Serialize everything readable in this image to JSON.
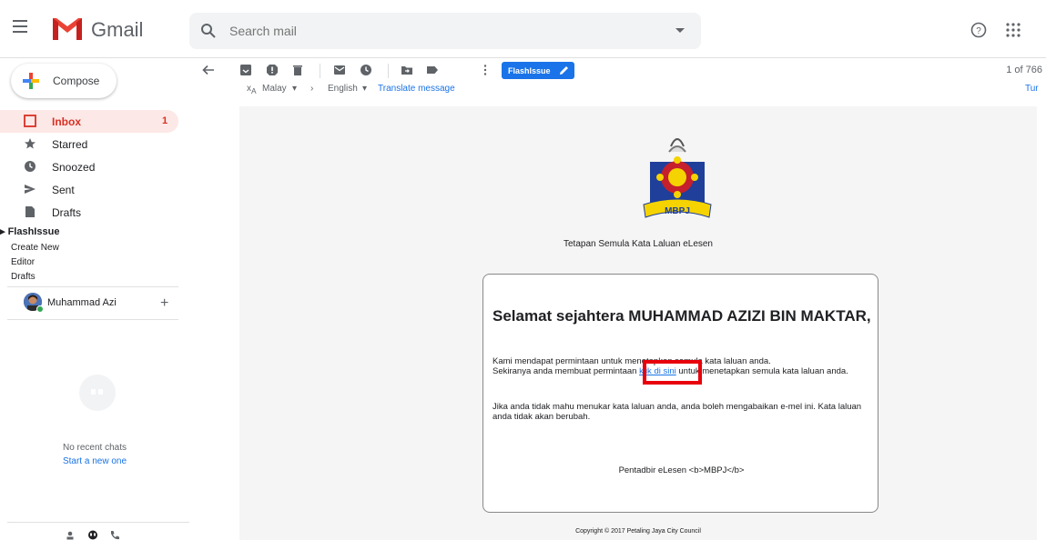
{
  "app": {
    "brand": "Gmail"
  },
  "search": {
    "placeholder": "Search mail"
  },
  "compose": {
    "label": "Compose"
  },
  "sidebar": {
    "items": [
      {
        "label": "Inbox",
        "count": "1",
        "icon": "inbox-icon",
        "active": true
      },
      {
        "label": "Starred",
        "icon": "star-icon"
      },
      {
        "label": "Snoozed",
        "icon": "clock-icon"
      },
      {
        "label": "Sent",
        "icon": "send-icon"
      },
      {
        "label": "Drafts",
        "icon": "draft-icon"
      }
    ],
    "label_group": {
      "title": "FlashIssue",
      "items": [
        "Create New",
        "Editor",
        "Drafts"
      ]
    },
    "user": {
      "name": "Muhammad Azi"
    },
    "chats": {
      "empty": "No recent chats",
      "start": "Start a new one"
    }
  },
  "toolbar": {
    "label_chip": "FlashIssue",
    "pager": "1 of 766"
  },
  "translate": {
    "from": "Malay",
    "to": "English",
    "action": "Translate message",
    "off": "Tur"
  },
  "email": {
    "heading": "Tetapan Semula Kata Laluan eLesen",
    "greeting": "Selamat sejahtera MUHAMMAD AZIZI BIN MAKTAR,",
    "line1": "Kami mendapat permintaan untuk menetapkan semula kata laluan anda.",
    "line2_pre": "Sekiranya anda membuat permintaan ",
    "link": "klik di sini",
    "line2_post": " untuk menetapkan semula kata laluan anda.",
    "para2": "Jika anda tidak mahu menukar kata laluan anda, anda boleh mengabaikan e-mel ini. Kata laluan anda tidak akan berubah.",
    "signature": "Pentadbir eLesen <b>MBPJ</b>",
    "copyright": "Copyright © 2017 Petaling Jaya City Council",
    "crest_text": "MBPJ"
  },
  "colors": {
    "accent": "#1a73e8",
    "inbox": "#d93025",
    "highlight": "#e8000b"
  }
}
